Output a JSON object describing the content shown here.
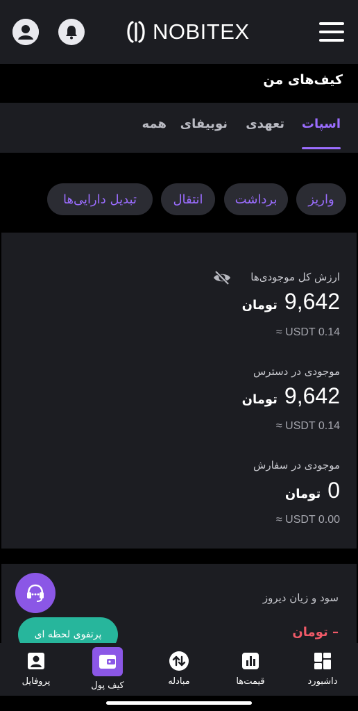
{
  "header": {
    "logo_text": "NOBITEX",
    "icons": [
      "user-circle-icon",
      "bell-icon",
      "menu-icon"
    ]
  },
  "page": {
    "title": "کیف‌های من"
  },
  "tabs": [
    {
      "label": "اسپات",
      "active": true
    },
    {
      "label": "تعهدی",
      "active": false
    },
    {
      "label": "نوبیفای",
      "active": false
    },
    {
      "label": "همه",
      "active": false
    }
  ],
  "actions": {
    "deposit": "واریز",
    "withdraw": "برداشت",
    "transfer": "انتقال",
    "convert": "تبدیل دارایی‌ها"
  },
  "balances": {
    "total": {
      "label": "ارزش کل موجودی‌ها",
      "value": "9,642",
      "unit": "تومان",
      "usdt": "≈ USDT 0.14"
    },
    "available": {
      "label": "موجودی در دسترس",
      "value": "9,642",
      "unit": "تومان",
      "usdt": "≈ USDT 0.14"
    },
    "in_orders": {
      "label": "موجودی در سفارش",
      "value": "0",
      "unit": "تومان",
      "usdt": "≈ USDT 0.00"
    }
  },
  "pnl": {
    "label": "سود و زیان دیروز",
    "value": "– تومان"
  },
  "instant_portfolio": "پرتفوی لحظه ای",
  "bottom_nav": [
    {
      "label": "داشبورد",
      "icon": "grid-icon"
    },
    {
      "label": "قیمت‌ها",
      "icon": "bar-chart-icon"
    },
    {
      "label": "مبادله",
      "icon": "swap-icon"
    },
    {
      "label": "کیف پول",
      "icon": "wallet-icon",
      "active": true
    },
    {
      "label": "پروفایل",
      "icon": "profile-icon"
    }
  ],
  "colors": {
    "accent": "#9b6dff",
    "accent_bg": "#8b57e6",
    "card_bg": "#1c1d22",
    "negative": "#f05a68",
    "teal": "#27b69c"
  }
}
